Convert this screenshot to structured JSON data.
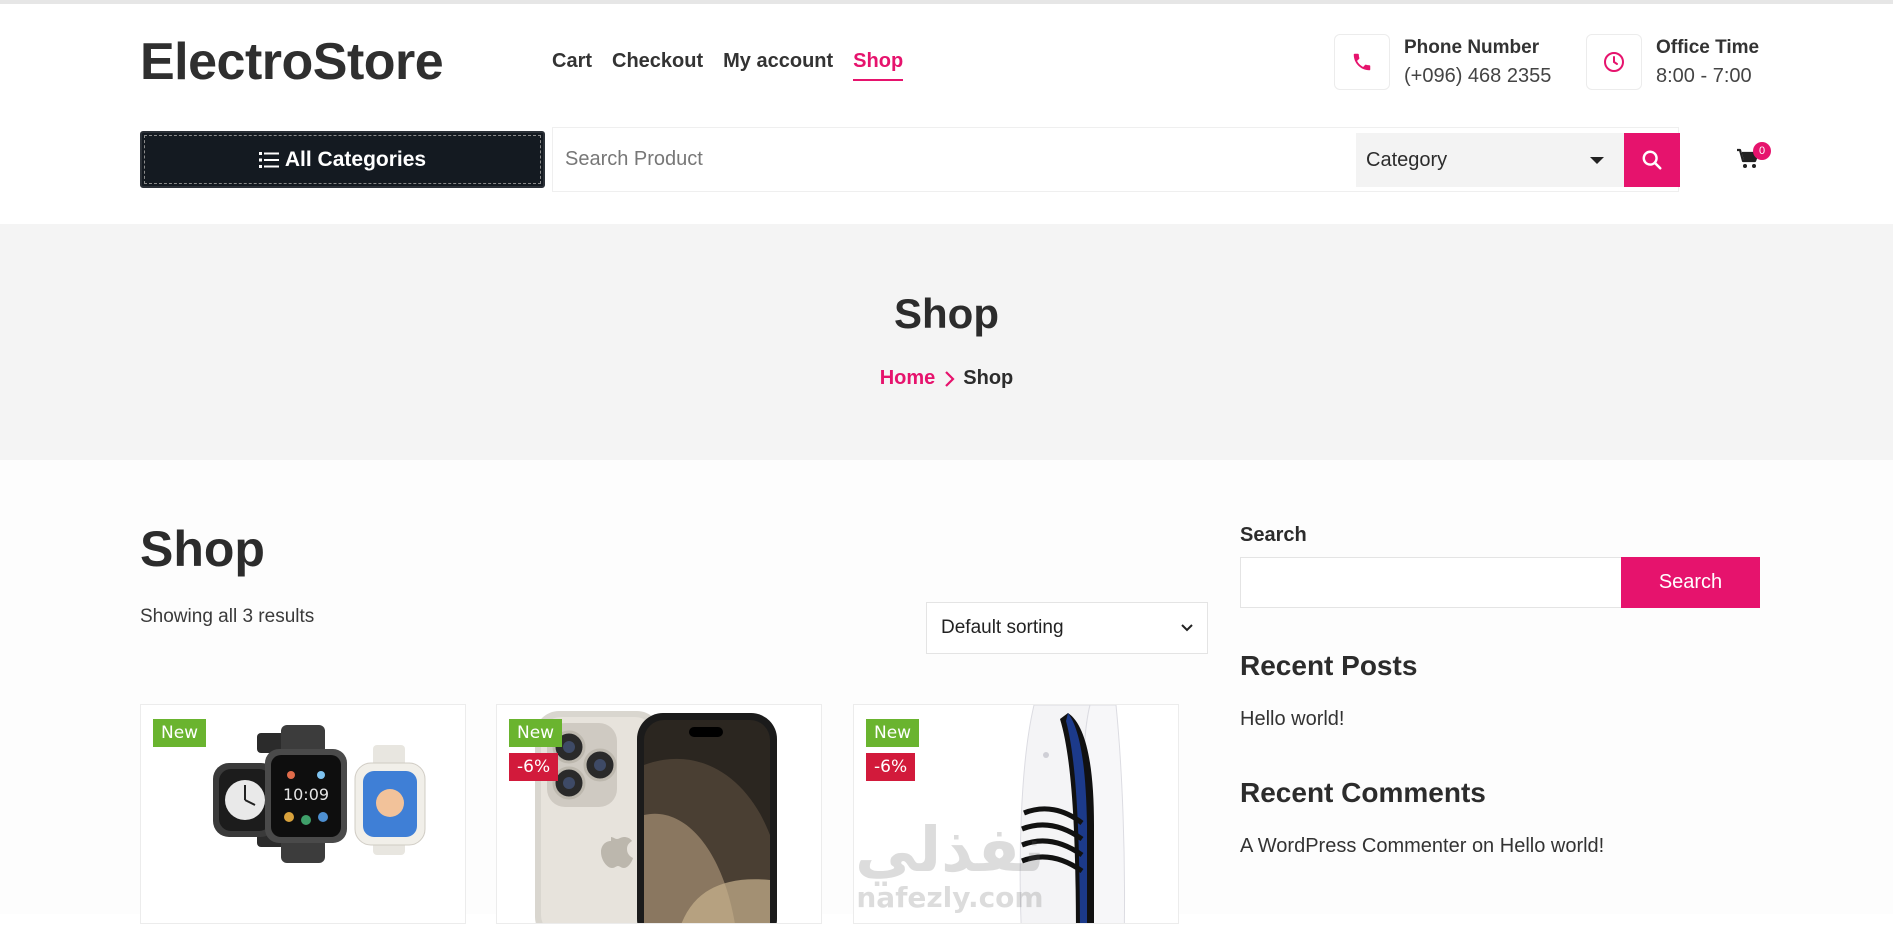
{
  "site": {
    "logo": "ElectroStore"
  },
  "nav": [
    {
      "label": "Cart",
      "active": false
    },
    {
      "label": "Checkout",
      "active": false
    },
    {
      "label": "My account",
      "active": false
    },
    {
      "label": "Shop",
      "active": true
    }
  ],
  "contact": {
    "phone_title": "Phone Number",
    "phone_value": "(+096) 468 2355",
    "office_title": "Office Time",
    "office_value": "8:00 - 7:00"
  },
  "toolbar": {
    "all_categories": "All Categories",
    "search_placeholder": "Search Product",
    "category_select": "Category",
    "cart_count": "0"
  },
  "banner": {
    "title": "Shop",
    "breadcrumb_home": "Home",
    "breadcrumb_current": "Shop"
  },
  "main": {
    "title": "Shop",
    "result_count": "Showing all 3 results",
    "sort_selected": "Default sorting"
  },
  "products": [
    {
      "image": "smartwatch-image",
      "badges": [
        "New"
      ]
    },
    {
      "image": "smartphone-image",
      "badges": [
        "New",
        "-6%"
      ]
    },
    {
      "image": "game-console-image",
      "badges": [
        "New",
        "-6%"
      ]
    }
  ],
  "sidebar": {
    "search_label": "Search",
    "search_button": "Search",
    "recent_posts_title": "Recent Posts",
    "recent_posts": [
      "Hello world!"
    ],
    "recent_comments_title": "Recent Comments",
    "comment_author": "A WordPress Commenter",
    "comment_on": "on",
    "comment_post": "Hello world!"
  },
  "watermark": {
    "text": "نفذلي",
    "subtext": "nafezly.com"
  },
  "colors": {
    "accent": "#e6136d",
    "dark": "#141a21",
    "new_badge": "#6ab42f",
    "sale_badge": "#d21a3b"
  }
}
